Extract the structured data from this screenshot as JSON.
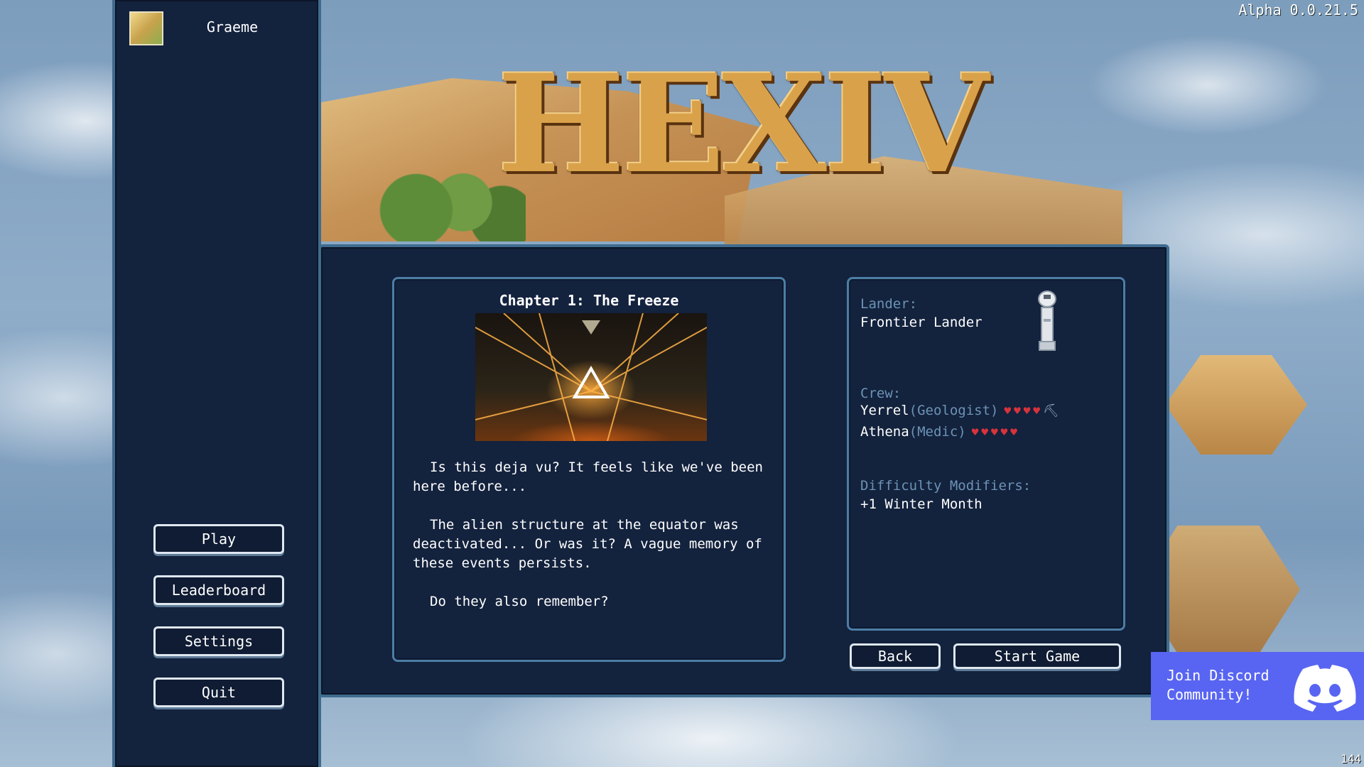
{
  "game": {
    "title": "HEXIV",
    "version": "Alpha 0.0.21.5",
    "fps": "144"
  },
  "user": {
    "name": "Graeme"
  },
  "menu": {
    "play": "Play",
    "leaderboard": "Leaderboard",
    "settings": "Settings",
    "quit": "Quit"
  },
  "chapter": {
    "title": "Chapter 1: The Freeze",
    "paragraphs": [
      "Is this deja vu? It feels like we've been here before...",
      "The alien structure at the equator was deactivated... Or was it? A vague memory of these events persists.",
      "Do they also remember?"
    ]
  },
  "setup": {
    "lander_label": "Lander:",
    "lander_value": "Frontier Lander",
    "crew_label": "Crew:",
    "crew": [
      {
        "name": "Yerrel",
        "role": "(Geologist)",
        "hearts": 4,
        "tool": "pickaxe-icon"
      },
      {
        "name": "Athena",
        "role": "(Medic)",
        "hearts": 5,
        "tool": ""
      }
    ],
    "difficulty_label": "Difficulty Modifiers:",
    "difficulty_value": "+1 Winter Month"
  },
  "actions": {
    "back": "Back",
    "start": "Start Game"
  },
  "discord": {
    "text": "Join Discord Community!"
  },
  "colors": {
    "panel_bg": "#13223d",
    "border": "#4c7ea6",
    "label": "#6c93b5",
    "heart": "#d9333b",
    "discord": "#5865f2",
    "title_gold": "#d9a24a"
  }
}
